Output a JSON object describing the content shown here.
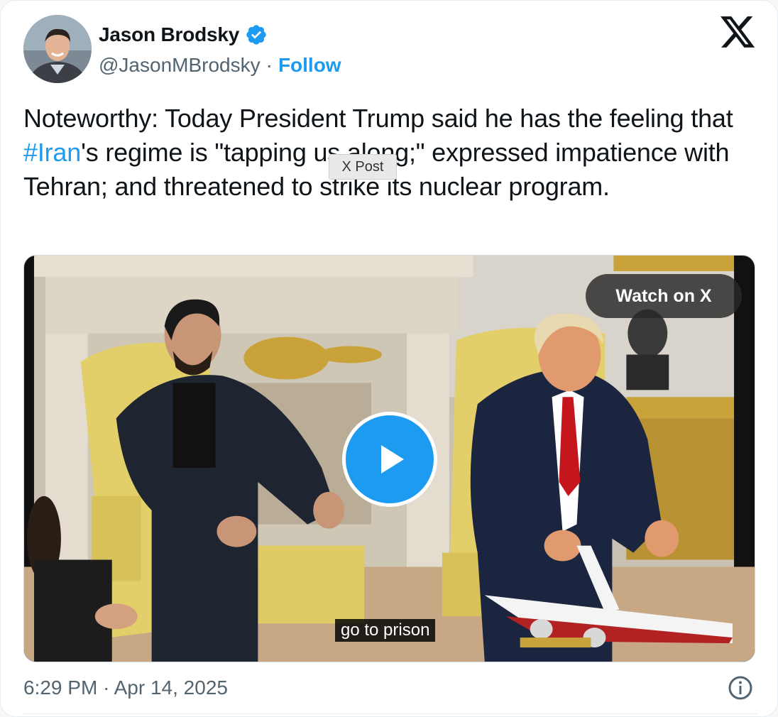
{
  "author": {
    "display_name": "Jason Brodsky",
    "handle": "@JasonMBrodsky",
    "separator": "·",
    "follow_label": "Follow",
    "verified": true,
    "avatar_icon": "person-photo"
  },
  "platform": {
    "logo": "x-logo",
    "brand_color": "#0f1419"
  },
  "tweet": {
    "part1": "Noteworthy: Today President Trump said he has the feeling that ",
    "hashtag": "#Iran",
    "part2": "'s regime is \"tapping us along;\" expressed impatience with Tehran; and threatened to strike its nuclear program."
  },
  "tooltip": {
    "text": "X Post"
  },
  "media": {
    "watch_label": "Watch on X",
    "caption": "go to prison",
    "play_icon": "play-icon"
  },
  "footer": {
    "time": "6:29 PM",
    "separator": "·",
    "date": "Apr 14, 2025",
    "info_icon": "info-icon"
  },
  "colors": {
    "accent": "#1d9bf0",
    "muted": "#536471"
  }
}
